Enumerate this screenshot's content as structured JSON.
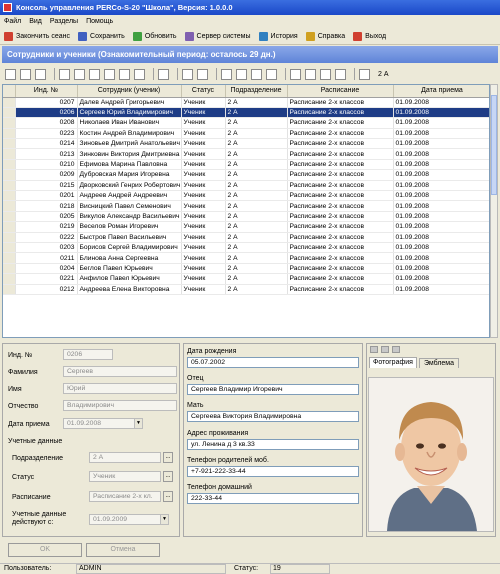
{
  "window": {
    "title": "Консоль управления PERCo-S-20 \"Школа\", Версия: 1.0.0.0"
  },
  "menu": {
    "items": [
      "Файл",
      "Вид",
      "Разделы",
      "Помощь"
    ]
  },
  "toolbar": {
    "buttons": [
      {
        "label": "Закончить сеанс",
        "color": "#d04030"
      },
      {
        "label": "Сохранить",
        "color": "#4060c0"
      },
      {
        "label": "Обновить",
        "color": "#40a040"
      },
      {
        "label": "Сервер системы",
        "color": "#8060b0"
      },
      {
        "label": "История",
        "color": "#3080c0"
      },
      {
        "label": "Справка",
        "color": "#d0a020"
      },
      {
        "label": "Выход",
        "color": "#d04030"
      }
    ]
  },
  "section": {
    "title": "Сотрудники и ученики (Ознакомительный период: осталось 29 дн.)"
  },
  "grid_toolbar": {
    "group_label": "2 А"
  },
  "table": {
    "columns": [
      "Инд. №",
      "Сотрудник (ученик)",
      "Статус",
      "Подразделение",
      "Расписание",
      "Дата приема"
    ],
    "rows": [
      [
        "0207",
        "Далев Андрей Григорьевич",
        "Ученик",
        "2 А",
        "Расписание 2-х классов",
        "01.09.2008"
      ],
      [
        "0206",
        "Сергеев Юрий Владимирович",
        "Ученик",
        "2 А",
        "Расписание 2-х классов",
        "01.09.2008"
      ],
      [
        "0208",
        "Николаев Иван Иванович",
        "Ученик",
        "2 А",
        "Расписание 2-х классов",
        "01.09.2008"
      ],
      [
        "0223",
        "Костин Андрей Владимирович",
        "Ученик",
        "2 А",
        "Расписание 2-х классов",
        "01.09.2008"
      ],
      [
        "0214",
        "Зиновьев Дмитрий Анатольевич",
        "Ученик",
        "2 А",
        "Расписание 2-х классов",
        "01.09.2008"
      ],
      [
        "0213",
        "Зинковин Виктория Дмитриевна",
        "Ученик",
        "2 А",
        "Расписание 2-х классов",
        "01.09.2008"
      ],
      [
        "0210",
        "Ефимова Марина Павловна",
        "Ученик",
        "2 А",
        "Расписание 2-х классов",
        "01.09.2008"
      ],
      [
        "0209",
        "Дубровская Мария Игоревна",
        "Ученик",
        "2 А",
        "Расписание 2-х классов",
        "01.09.2008"
      ],
      [
        "0215",
        "Дворковский Генрих Робертович",
        "Ученик",
        "2 А",
        "Расписание 2-х классов",
        "01.09.2008"
      ],
      [
        "0201",
        "Андреев Андрей Андреевич",
        "Ученик",
        "2 А",
        "Расписание 2-х классов",
        "01.09.2008"
      ],
      [
        "0218",
        "Висницкий Павел Семенович",
        "Ученик",
        "2 А",
        "Расписание 2-х классов",
        "01.09.2008"
      ],
      [
        "0205",
        "Викулов Александр Васильевич",
        "Ученик",
        "2 А",
        "Расписание 2-х классов",
        "01.09.2008"
      ],
      [
        "0219",
        "Веселов Роман Игоревич",
        "Ученик",
        "2 А",
        "Расписание 2-х классов",
        "01.09.2008"
      ],
      [
        "0222",
        "Быстров Павел Васильевич",
        "Ученик",
        "2 А",
        "Расписание 2-х классов",
        "01.09.2008"
      ],
      [
        "0203",
        "Борисов Сергей Владимирович",
        "Ученик",
        "2 А",
        "Расписание 2-х классов",
        "01.09.2008"
      ],
      [
        "0211",
        "Блинова Анна Сергеевна",
        "Ученик",
        "2 А",
        "Расписание 2-х классов",
        "01.09.2008"
      ],
      [
        "0204",
        "Беглов Павел Юрьевич",
        "Ученик",
        "2 А",
        "Расписание 2-х классов",
        "01.09.2008"
      ],
      [
        "0221",
        "Анфилов Павел Юрьевич",
        "Ученик",
        "2 А",
        "Расписание 2-х классов",
        "01.09.2008"
      ],
      [
        "0212",
        "Андреева Елена Викторовна",
        "Ученик",
        "2 А",
        "Расписание 2-х классов",
        "01.09.2008"
      ]
    ],
    "selected_index": 1
  },
  "details": {
    "id_label": "Инд. №",
    "id_value": "0206",
    "surname_label": "Фамилия",
    "surname_value": "Сергеев",
    "name_label": "Имя",
    "name_value": "Юрий",
    "patronymic_label": "Отчество",
    "patronymic_value": "Владимирович",
    "hire_label": "Дата приема",
    "hire_value": "01.09.2008",
    "account_group": "Учетные данные",
    "dept_label": "Подразделение",
    "dept_value": "2 А",
    "status_label": "Статус",
    "status_value": "Ученик",
    "schedule_label": "Расписание",
    "schedule_value": "Расписание 2-х кл.",
    "valid_label_1": "Учетные данные",
    "valid_label_2": "действуют с:",
    "valid_value": "01.09.2009"
  },
  "personal": {
    "birth_label": "Дата рождения",
    "birth_value": "05.07.2002",
    "father_label": "Отец",
    "father_value": "Сергеев Владимир Игоревич",
    "mother_label": "Мать",
    "mother_value": "Сергеева Виктория Владимировна",
    "address_label": "Адрес проживания",
    "address_value": "ул. Ленина д 3 кв.33",
    "parents_phone_label": "Телефон родителей моб.",
    "parents_phone_value": "+7-921-222-33-44",
    "home_phone_label": "Телефон домашний",
    "home_phone_value": "222-33-44"
  },
  "photo_tabs": [
    "Фотография",
    "Эмблема"
  ],
  "buttons": {
    "ok": "OK",
    "cancel": "Отмена"
  },
  "status": {
    "user_label": "Пользователь:",
    "user_value": "ADMIN",
    "status_label": "Статус:",
    "status_value": "19"
  }
}
